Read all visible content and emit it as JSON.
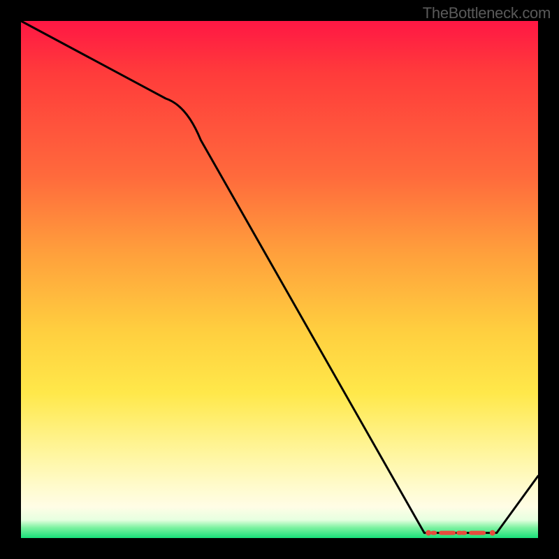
{
  "attribution": "TheBottleneck.com",
  "chart_data": {
    "type": "line",
    "title": "",
    "xlabel": "",
    "ylabel": "",
    "xlim": [
      0,
      100
    ],
    "ylim": [
      0,
      100
    ],
    "x": [
      0,
      28,
      78,
      92,
      100
    ],
    "values": [
      100,
      85,
      1,
      1,
      12
    ],
    "flat_segment": {
      "x_start": 78,
      "x_end": 92,
      "y": 1
    },
    "gradient_stops": [
      {
        "pct": 0,
        "color": "#ff1744"
      },
      {
        "pct": 45,
        "color": "#ffa03c"
      },
      {
        "pct": 72,
        "color": "#ffe84a"
      },
      {
        "pct": 94,
        "color": "#fffde6"
      },
      {
        "pct": 100,
        "color": "#18e07a"
      }
    ]
  }
}
